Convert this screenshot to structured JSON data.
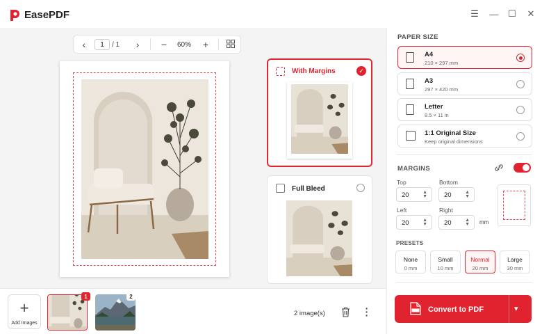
{
  "app": {
    "name": "EasePDF"
  },
  "toolbar": {
    "page_current": "1",
    "page_total": "/ 1",
    "zoom": "60%"
  },
  "layout_options": [
    {
      "label": "With Margins",
      "selected": true
    },
    {
      "label": "Full Bleed",
      "selected": false
    }
  ],
  "paper_size": {
    "title": "PAPER SIZE",
    "options": [
      {
        "name": "A4",
        "dims": "210 × 297 mm",
        "selected": true
      },
      {
        "name": "A3",
        "dims": "297 × 420 mm",
        "selected": false
      },
      {
        "name": "Letter",
        "dims": "8.5 × 11 in",
        "selected": false
      },
      {
        "name": "1:1 Original Size",
        "dims": "Keep original dimensions",
        "selected": false
      }
    ]
  },
  "margins": {
    "title": "MARGINS",
    "enabled": true,
    "top_label": "Top",
    "top": "20",
    "bottom_label": "Bottom",
    "bottom": "20",
    "left_label": "Left",
    "left": "20",
    "right_label": "Right",
    "right": "20",
    "unit": "mm"
  },
  "presets": {
    "title": "PRESETS",
    "items": [
      {
        "name": "None",
        "value": "0 mm",
        "selected": false
      },
      {
        "name": "Small",
        "value": "10 mm",
        "selected": false
      },
      {
        "name": "Normal",
        "value": "20 mm",
        "selected": true
      },
      {
        "name": "Large",
        "value": "30 mm",
        "selected": false
      }
    ]
  },
  "bottom_bar": {
    "add_label": "Add Images",
    "thumbs": [
      {
        "badge": "1"
      },
      {
        "badge": "2"
      }
    ],
    "count": "2 image(s)"
  },
  "convert": {
    "label": "Convert to PDF"
  },
  "colors": {
    "accent": "#e0232f"
  }
}
